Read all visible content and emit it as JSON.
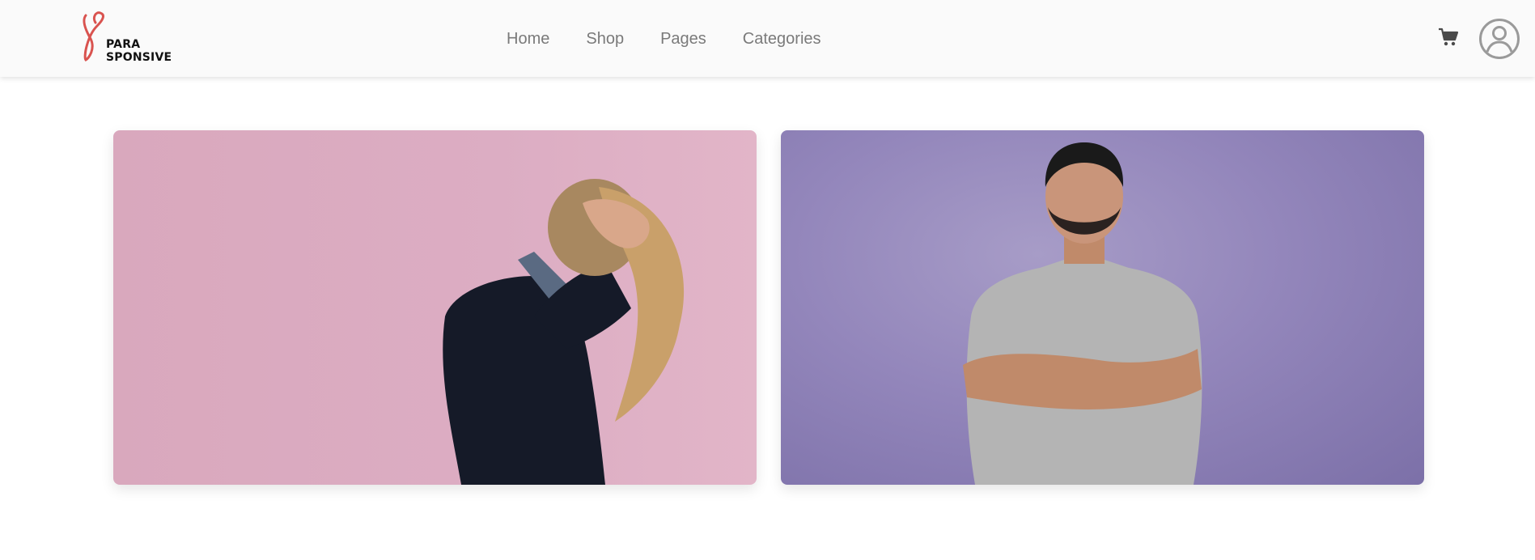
{
  "brand": {
    "line1": "PARA",
    "line2": "SPONSIVE",
    "accent_color": "#d9534f"
  },
  "nav": {
    "items": [
      {
        "label": "Home"
      },
      {
        "label": "Shop"
      },
      {
        "label": "Pages"
      },
      {
        "label": "Categories"
      }
    ]
  },
  "header_actions": {
    "cart_icon": "shopping-cart-icon",
    "account_icon": "user-circle-icon"
  },
  "cards": [
    {
      "image": "woman-covering-face-pink-background",
      "background_color": "#dcadc3"
    },
    {
      "image": "smiling-man-crossed-arms-purple-background",
      "background_color": "#9386bb"
    }
  ]
}
